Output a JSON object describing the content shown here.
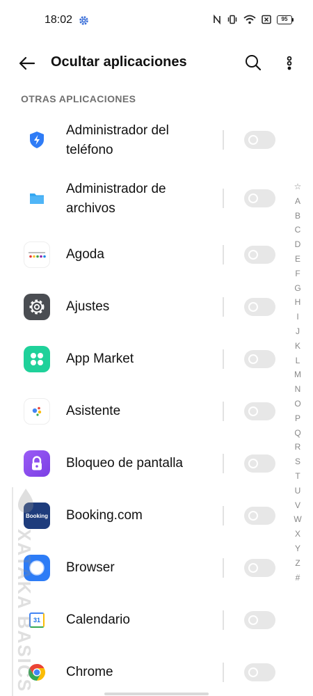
{
  "status_bar": {
    "time": "18:02",
    "battery": "95",
    "icons": [
      "gear-icon",
      "nfc-icon",
      "vibrate-icon",
      "wifi-icon",
      "sim-off-icon",
      "battery-icon"
    ]
  },
  "app_bar": {
    "title": "Ocultar aplicaciones",
    "back_icon": "arrow-left-icon",
    "search_icon": "search-icon",
    "more_icon": "more-vertical-icon"
  },
  "section": {
    "header": "OTRAS APLICACIONES"
  },
  "apps": [
    {
      "label_line1": "Administrador del",
      "label_line2": "teléfono",
      "icon": "phone-manager-icon",
      "hidden": false
    },
    {
      "label_line1": "Administrador de",
      "label_line2": "archivos",
      "icon": "folder-icon",
      "hidden": false
    },
    {
      "label": "Agoda",
      "icon": "agoda-icon",
      "hidden": false
    },
    {
      "label": "Ajustes",
      "icon": "settings-icon",
      "hidden": false
    },
    {
      "label": "App Market",
      "icon": "app-market-icon",
      "hidden": false
    },
    {
      "label": "Asistente",
      "icon": "assistant-icon",
      "hidden": false
    },
    {
      "label": "Bloqueo de pantalla",
      "icon": "lock-screen-icon",
      "hidden": false
    },
    {
      "label": "Booking.com",
      "icon_text": "Booking",
      "icon": "booking-icon",
      "hidden": false
    },
    {
      "label": "Browser",
      "icon": "browser-icon",
      "hidden": false
    },
    {
      "label": "Calendario",
      "icon_text": "31",
      "icon": "calendar-icon",
      "hidden": false
    },
    {
      "label": "Chrome",
      "icon": "chrome-icon",
      "hidden": false
    }
  ],
  "alphabet_index": [
    "☆",
    "A",
    "B",
    "C",
    "D",
    "E",
    "F",
    "G",
    "H",
    "I",
    "J",
    "K",
    "L",
    "M",
    "N",
    "O",
    "P",
    "Q",
    "R",
    "S",
    "T",
    "U",
    "V",
    "W",
    "X",
    "Y",
    "Z",
    "#"
  ],
  "watermark": {
    "text": "XATAKA BASICS"
  },
  "colors": {
    "toggle_off": "#e7e7e7",
    "section_header": "#707070",
    "text": "#111111"
  }
}
